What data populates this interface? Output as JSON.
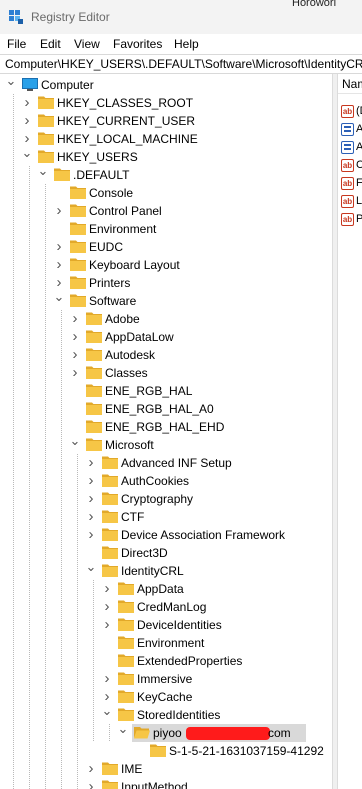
{
  "window": {
    "title": "Registry Editor",
    "app_icon": "registry-editor-icon",
    "background_peek_text": "Horoworl"
  },
  "menu": [
    "File",
    "Edit",
    "View",
    "Favorites",
    "Help"
  ],
  "address_bar": {
    "path": "Computer\\HKEY_USERS\\.DEFAULT\\Software\\Microsoft\\IdentityCRL\\StoredIdentities\\piyoo"
  },
  "colors": {
    "folder": "#f6c646",
    "folder_dark": "#e2a92a",
    "selection": "#d9d9d9",
    "redaction": "#ff1b1b"
  },
  "tree": [
    {
      "label": "Computer",
      "icon": "computer-icon",
      "depth": 0,
      "state": "expanded"
    },
    {
      "label": "HKEY_CLASSES_ROOT",
      "icon": "folder-icon",
      "depth": 1,
      "state": "collapsed"
    },
    {
      "label": "HKEY_CURRENT_USER",
      "icon": "folder-icon",
      "depth": 1,
      "state": "collapsed"
    },
    {
      "label": "HKEY_LOCAL_MACHINE",
      "icon": "folder-icon",
      "depth": 1,
      "state": "collapsed"
    },
    {
      "label": "HKEY_USERS",
      "icon": "folder-icon",
      "depth": 1,
      "state": "expanded"
    },
    {
      "label": ".DEFAULT",
      "icon": "folder-icon",
      "depth": 2,
      "state": "expanded"
    },
    {
      "label": "Console",
      "icon": "folder-icon",
      "depth": 3,
      "state": "leaf"
    },
    {
      "label": "Control Panel",
      "icon": "folder-icon",
      "depth": 3,
      "state": "collapsed"
    },
    {
      "label": "Environment",
      "icon": "folder-icon",
      "depth": 3,
      "state": "leaf"
    },
    {
      "label": "EUDC",
      "icon": "folder-icon",
      "depth": 3,
      "state": "collapsed"
    },
    {
      "label": "Keyboard Layout",
      "icon": "folder-icon",
      "depth": 3,
      "state": "collapsed"
    },
    {
      "label": "Printers",
      "icon": "folder-icon",
      "depth": 3,
      "state": "collapsed"
    },
    {
      "label": "Software",
      "icon": "folder-icon",
      "depth": 3,
      "state": "expanded"
    },
    {
      "label": "Adobe",
      "icon": "folder-icon",
      "depth": 4,
      "state": "collapsed"
    },
    {
      "label": "AppDataLow",
      "icon": "folder-icon",
      "depth": 4,
      "state": "collapsed"
    },
    {
      "label": "Autodesk",
      "icon": "folder-icon",
      "depth": 4,
      "state": "collapsed"
    },
    {
      "label": "Classes",
      "icon": "folder-icon",
      "depth": 4,
      "state": "collapsed"
    },
    {
      "label": "ENE_RGB_HAL",
      "icon": "folder-icon",
      "depth": 4,
      "state": "leaf"
    },
    {
      "label": "ENE_RGB_HAL_A0",
      "icon": "folder-icon",
      "depth": 4,
      "state": "leaf"
    },
    {
      "label": "ENE_RGB_HAL_EHD",
      "icon": "folder-icon",
      "depth": 4,
      "state": "leaf"
    },
    {
      "label": "Microsoft",
      "icon": "folder-icon",
      "depth": 4,
      "state": "expanded"
    },
    {
      "label": "Advanced INF Setup",
      "icon": "folder-icon",
      "depth": 5,
      "state": "collapsed"
    },
    {
      "label": "AuthCookies",
      "icon": "folder-icon",
      "depth": 5,
      "state": "collapsed"
    },
    {
      "label": "Cryptography",
      "icon": "folder-icon",
      "depth": 5,
      "state": "collapsed"
    },
    {
      "label": "CTF",
      "icon": "folder-icon",
      "depth": 5,
      "state": "collapsed"
    },
    {
      "label": "Device Association Framework",
      "icon": "folder-icon",
      "depth": 5,
      "state": "collapsed"
    },
    {
      "label": "Direct3D",
      "icon": "folder-icon",
      "depth": 5,
      "state": "leaf"
    },
    {
      "label": "IdentityCRL",
      "icon": "folder-icon",
      "depth": 5,
      "state": "expanded"
    },
    {
      "label": "AppData",
      "icon": "folder-icon",
      "depth": 6,
      "state": "collapsed"
    },
    {
      "label": "CredManLog",
      "icon": "folder-icon",
      "depth": 6,
      "state": "collapsed"
    },
    {
      "label": "DeviceIdentities",
      "icon": "folder-icon",
      "depth": 6,
      "state": "collapsed"
    },
    {
      "label": "Environment",
      "icon": "folder-icon",
      "depth": 6,
      "state": "leaf"
    },
    {
      "label": "ExtendedProperties",
      "icon": "folder-icon",
      "depth": 6,
      "state": "leaf"
    },
    {
      "label": "Immersive",
      "icon": "folder-icon",
      "depth": 6,
      "state": "collapsed"
    },
    {
      "label": "KeyCache",
      "icon": "folder-icon",
      "depth": 6,
      "state": "collapsed"
    },
    {
      "label": "StoredIdentities",
      "icon": "folder-icon",
      "depth": 6,
      "state": "expanded"
    },
    {
      "label": "piyoo",
      "label_suffix": "com",
      "icon": "open-folder-icon",
      "depth": 7,
      "state": "expanded",
      "selected": true,
      "redacted": true
    },
    {
      "label": "S-1-5-21-1631037159-41292",
      "icon": "folder-icon",
      "depth": 8,
      "state": "leaf"
    },
    {
      "label": "IME",
      "icon": "folder-icon",
      "depth": 5,
      "state": "collapsed"
    },
    {
      "label": "InputMethod",
      "icon": "folder-icon",
      "depth": 5,
      "state": "collapsed"
    }
  ],
  "values_pane": {
    "column_header": "Name",
    "rows": [
      {
        "icon": "string-value-icon",
        "label": "(Default)"
      },
      {
        "icon": "binary-value-icon",
        "label": "A"
      },
      {
        "icon": "binary-value-icon",
        "label": "A"
      },
      {
        "icon": "string-value-icon",
        "label": "C"
      },
      {
        "icon": "string-value-icon",
        "label": "F"
      },
      {
        "icon": "string-value-icon",
        "label": "L"
      },
      {
        "icon": "string-value-icon",
        "label": "P"
      }
    ]
  }
}
